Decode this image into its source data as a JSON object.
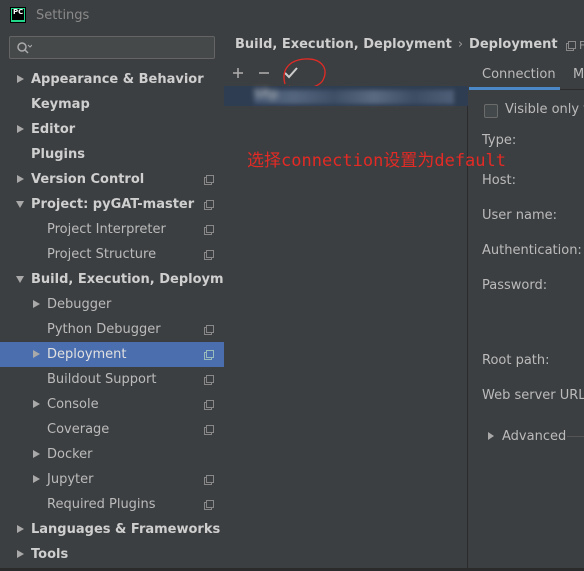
{
  "window": {
    "title": "Settings",
    "logo_text": "PC"
  },
  "search": {
    "placeholder": "",
    "value": ""
  },
  "tree": {
    "items": [
      {
        "label": "Appearance & Behavior",
        "bold": true
      },
      {
        "label": "Keymap",
        "bold": true
      },
      {
        "label": "Editor",
        "bold": true
      },
      {
        "label": "Plugins",
        "bold": true
      },
      {
        "label": "Version Control",
        "bold": true
      },
      {
        "label": "Project: pyGAT-master",
        "bold": true
      },
      {
        "label": "Project Interpreter",
        "bold": false
      },
      {
        "label": "Project Structure",
        "bold": false
      },
      {
        "label": "Build, Execution, Deployment",
        "bold": true
      },
      {
        "label": "Debugger",
        "bold": false
      },
      {
        "label": "Python Debugger",
        "bold": false
      },
      {
        "label": "Deployment",
        "bold": false
      },
      {
        "label": "Buildout Support",
        "bold": false
      },
      {
        "label": "Console",
        "bold": false
      },
      {
        "label": "Coverage",
        "bold": false
      },
      {
        "label": "Docker",
        "bold": false
      },
      {
        "label": "Jupyter",
        "bold": false
      },
      {
        "label": "Required Plugins",
        "bold": false
      },
      {
        "label": "Languages & Frameworks",
        "bold": true
      },
      {
        "label": "Tools",
        "bold": true
      }
    ]
  },
  "breadcrumb": {
    "parent": "Build, Execution, Deployment",
    "separator": "›",
    "current": "Deployment",
    "right_text": "F"
  },
  "toolbar": {
    "add_label": "+",
    "remove_label": "−",
    "default_label": "✓"
  },
  "server_list": {
    "selected_server": "Sftp"
  },
  "annotation": {
    "text": "选择connection设置为default",
    "color": "#e32a25"
  },
  "tabs": {
    "connection": "Connection",
    "mappings": "M"
  },
  "form": {
    "visible_only": "Visible only fo",
    "type_label": "Type:",
    "host_label": "Host:",
    "username_label": "User name:",
    "auth_label": "Authentication:",
    "password_label": "Password:",
    "root_path_label": "Root path:",
    "web_url_label": "Web server URL:",
    "advanced_label": "Advanced"
  },
  "colors": {
    "accent": "#4b6eaf",
    "background": "#3c3f41",
    "text": "#bbbbbb"
  }
}
